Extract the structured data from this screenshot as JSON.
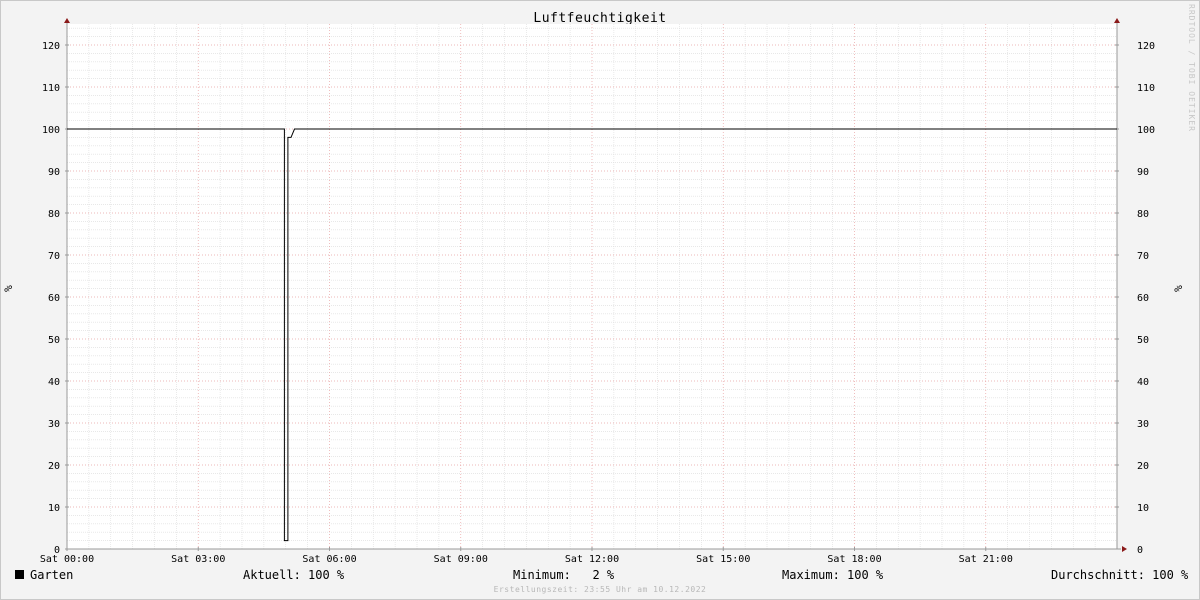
{
  "chart_data": {
    "type": "line",
    "title": "Luftfeuchtigkeit",
    "ylabel": "%",
    "ylim": [
      0,
      125
    ],
    "yticks": [
      0,
      10,
      20,
      30,
      40,
      50,
      60,
      70,
      80,
      90,
      100,
      110,
      120
    ],
    "xlim_hours": [
      0,
      24
    ],
    "xticks": [
      {
        "h": 0,
        "label": "Sat 00:00"
      },
      {
        "h": 3,
        "label": "Sat 03:00"
      },
      {
        "h": 6,
        "label": "Sat 06:00"
      },
      {
        "h": 9,
        "label": "Sat 09:00"
      },
      {
        "h": 12,
        "label": "Sat 12:00"
      },
      {
        "h": 15,
        "label": "Sat 15:00"
      },
      {
        "h": 18,
        "label": "Sat 18:00"
      },
      {
        "h": 21,
        "label": "Sat 21:00"
      }
    ],
    "grid": true,
    "series": [
      {
        "name": "Garten",
        "color": "#000000",
        "points": [
          [
            0,
            100
          ],
          [
            4.97,
            100
          ],
          [
            4.97,
            2
          ],
          [
            5.05,
            2
          ],
          [
            5.05,
            98
          ],
          [
            5.12,
            98
          ],
          [
            5.2,
            100
          ],
          [
            24,
            100
          ]
        ]
      }
    ]
  },
  "legend": {
    "series_name": "Garten",
    "current": "Aktuell: 100 %",
    "minimum": "Minimum:   2 %",
    "maximum": "Maximum: 100 %",
    "average": "Durchschnitt: 100 %"
  },
  "watermark": "RRDTOOL / TOBI OETIKER",
  "footer": "Erstellungszeit: 23:55 Uhr am 10.12.2022"
}
